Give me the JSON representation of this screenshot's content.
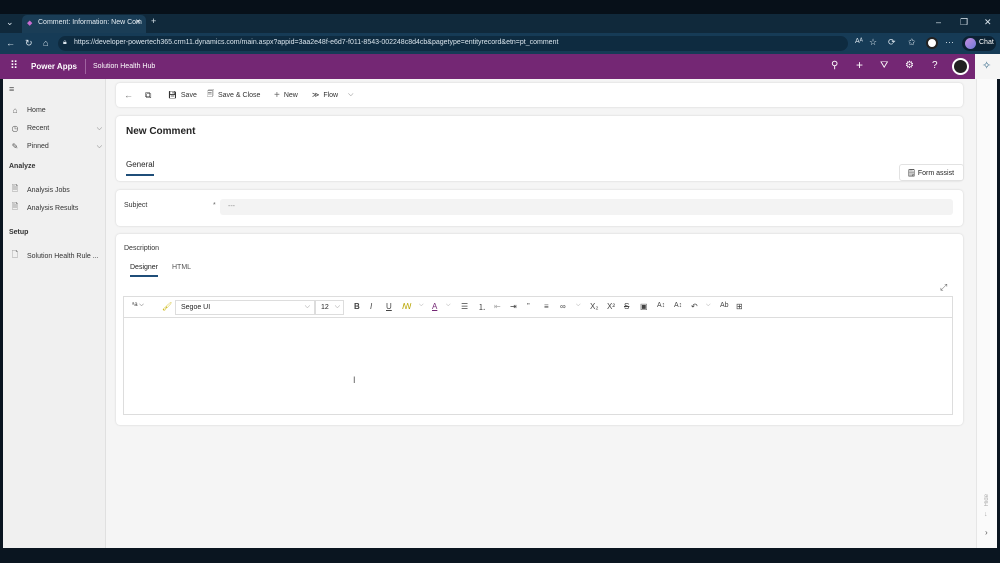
{
  "browser": {
    "tab_title": "Comment: Information: New Com",
    "url": "https://developer-powertech365.crm11.dynamics.com/main.aspx?appid=3aa2e48f-e6d7-f011-8543-002248c8d4cb&pagetype=entityrecord&etn=pt_comment",
    "chat_label": "Chat"
  },
  "app": {
    "name": "Power Apps",
    "area": "Solution Health Hub",
    "accent": "#742774"
  },
  "sidebar": {
    "items": [
      {
        "label": "Home",
        "icon": "home-icon"
      },
      {
        "label": "Recent",
        "icon": "clock-icon"
      },
      {
        "label": "Pinned",
        "icon": "pin-icon"
      }
    ],
    "sections": [
      {
        "title": "Analyze",
        "items": [
          {
            "label": "Analysis Jobs"
          },
          {
            "label": "Analysis Results"
          }
        ]
      },
      {
        "title": "Setup",
        "items": [
          {
            "label": "Solution Health Rule ..."
          }
        ]
      }
    ]
  },
  "commandbar": {
    "save": "Save",
    "save_close": "Save & Close",
    "new": "New",
    "flow": "Flow"
  },
  "form": {
    "title": "New Comment",
    "tab": "General",
    "form_assist": "Form assist",
    "subject_label": "Subject",
    "required_marker": "*",
    "subject_value": "---",
    "description_label": "Description",
    "editor_tabs": [
      "Designer",
      "HTML"
    ],
    "font": "Segoe UI",
    "font_size": "12"
  },
  "right_pane": {
    "hide_label": "Hide"
  }
}
